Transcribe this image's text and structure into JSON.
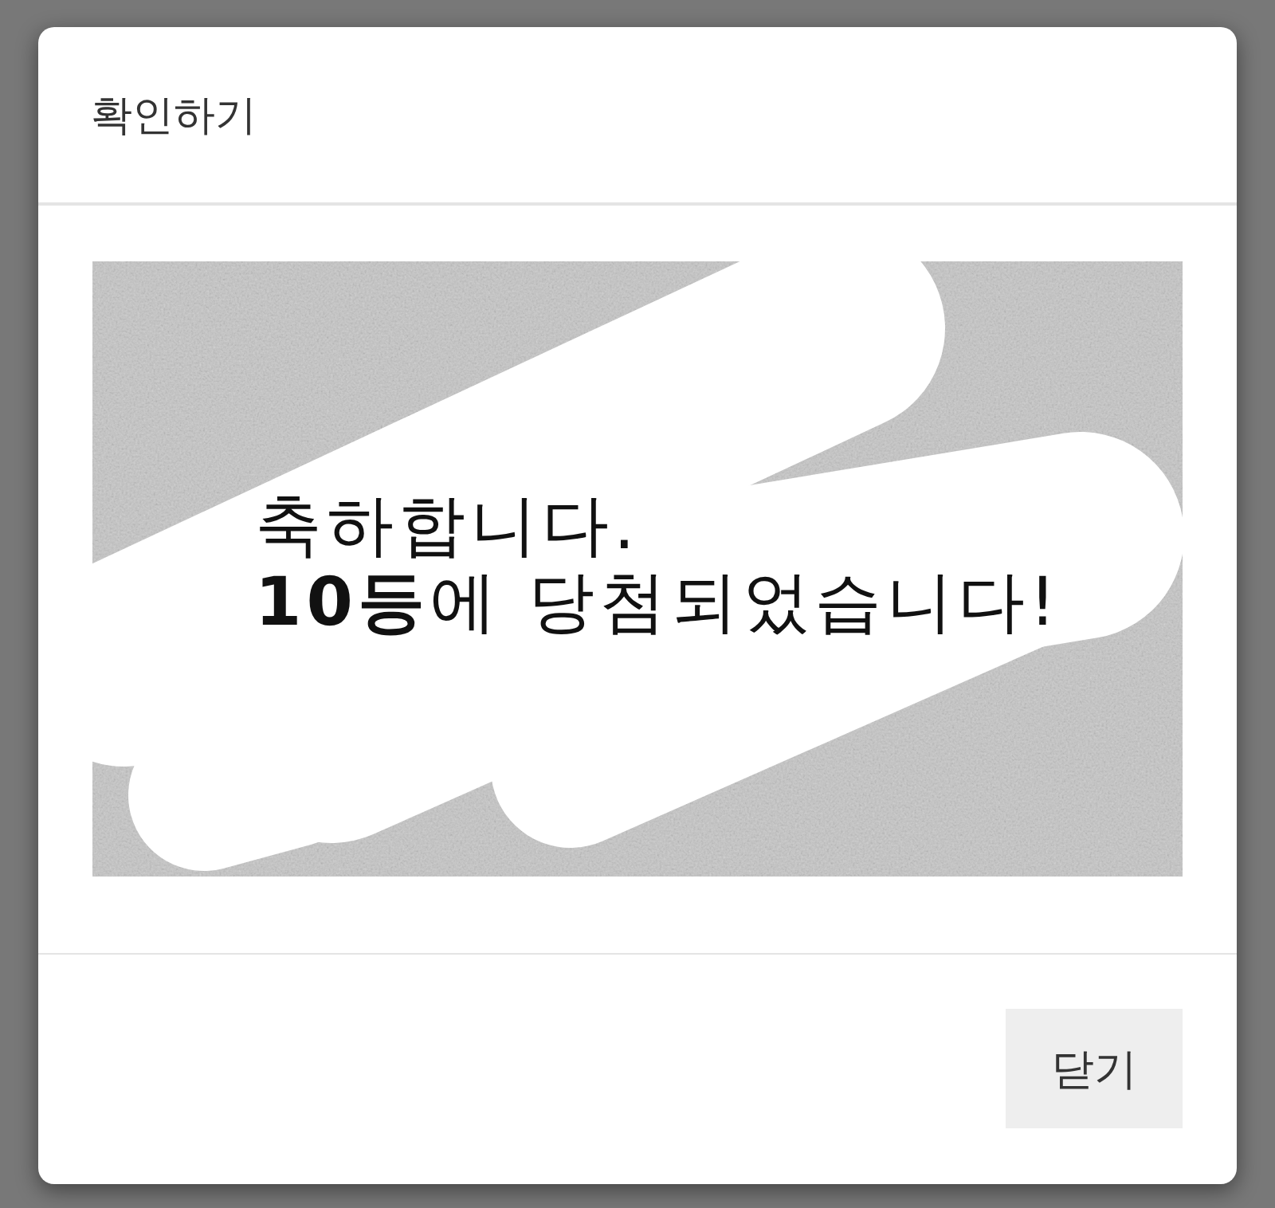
{
  "dialog": {
    "title": "확인하기",
    "scratch_card": {
      "message_lines": [
        "축하합니다.",
        "**10등**에 당첨되었습니다!"
      ]
    },
    "buttons": [
      {
        "label": "닫기"
      }
    ]
  }
}
